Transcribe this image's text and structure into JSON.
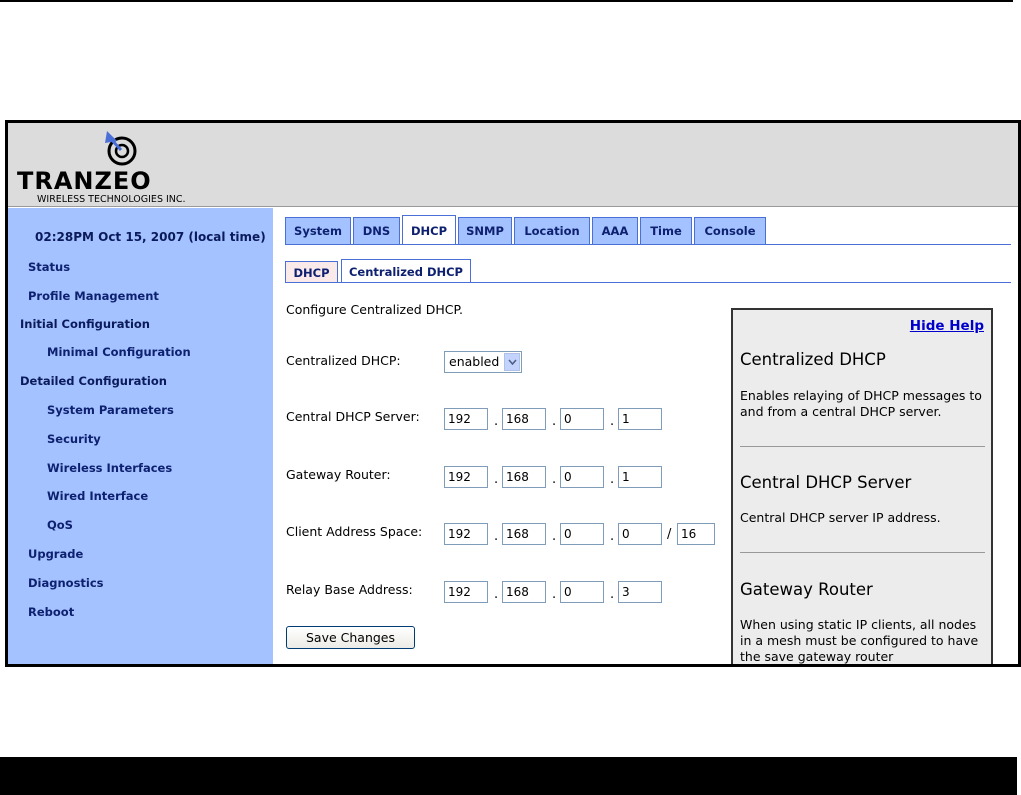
{
  "logo": {
    "brand": "TRANZEO",
    "tagline": "WIRELESS TECHNOLOGIES INC."
  },
  "sidebar": {
    "clock": "02:28PM Oct 15, 2007 (local time)",
    "items": [
      {
        "label": "Status"
      },
      {
        "label": "Profile Management"
      },
      {
        "label": "Initial Configuration"
      },
      {
        "label": "Minimal Configuration"
      },
      {
        "label": "Detailed Configuration"
      },
      {
        "label": "System Parameters"
      },
      {
        "label": "Security"
      },
      {
        "label": "Wireless Interfaces"
      },
      {
        "label": "Wired Interface"
      },
      {
        "label": "QoS"
      },
      {
        "label": "Upgrade"
      },
      {
        "label": "Diagnostics"
      },
      {
        "label": "Reboot"
      }
    ]
  },
  "tabs": [
    {
      "label": "System"
    },
    {
      "label": "DNS"
    },
    {
      "label": "DHCP"
    },
    {
      "label": "SNMP"
    },
    {
      "label": "Location"
    },
    {
      "label": "AAA"
    },
    {
      "label": "Time"
    },
    {
      "label": "Console"
    }
  ],
  "active_tab": "DHCP",
  "subtabs": [
    {
      "label": "DHCP"
    },
    {
      "label": "Centralized DHCP"
    }
  ],
  "active_subtab": "Centralized DHCP",
  "form": {
    "intro": "Configure Centralized DHCP.",
    "centralized_dhcp": {
      "label": "Centralized DHCP:",
      "value": "enabled"
    },
    "central_server": {
      "label": "Central DHCP Server:",
      "octets": [
        "192",
        "168",
        "0",
        "1"
      ]
    },
    "gateway": {
      "label": "Gateway Router:",
      "octets": [
        "192",
        "168",
        "0",
        "1"
      ]
    },
    "client_space": {
      "label": "Client Address Space:",
      "octets": [
        "192",
        "168",
        "0",
        "0"
      ],
      "separator": "/",
      "prefix": "16"
    },
    "relay_base": {
      "label": "Relay Base Address:",
      "octets": [
        "192",
        "168",
        "0",
        "3"
      ]
    },
    "dot": ".",
    "save_label": "Save Changes"
  },
  "help": {
    "hide_label": "Hide Help",
    "sections": [
      {
        "title": "Centralized DHCP",
        "body": "Enables relaying of DHCP messages to and from a central DHCP server."
      },
      {
        "title": "Central DHCP Server",
        "body": "Central DHCP server IP address."
      },
      {
        "title": "Gateway Router",
        "body": "When using static IP clients, all nodes in a mesh must be configured to have the save gateway router"
      }
    ]
  },
  "colors": {
    "sidebar_bg": "#a4c2ff",
    "header_bg": "#dcdcdc",
    "nav_text": "#0e2170",
    "link": "#0000cc"
  },
  "icons": {
    "logo_mark": "signal-swirl-icon",
    "select_arrow": "chevron-down-icon"
  }
}
